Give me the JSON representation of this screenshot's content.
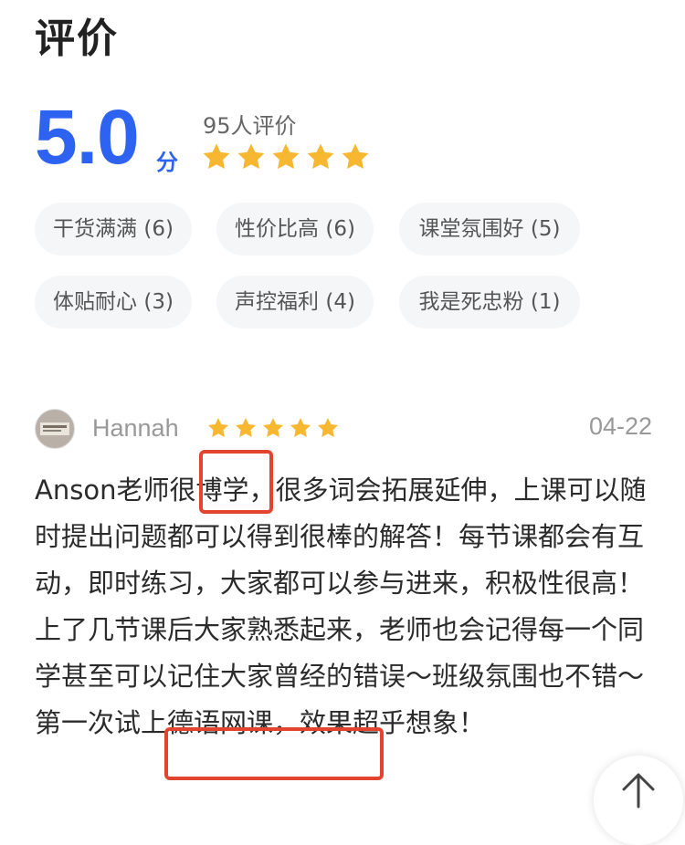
{
  "header": {
    "title": "评价"
  },
  "summary": {
    "score": "5.0",
    "unit": "分",
    "count": "95人评价",
    "rating": 5,
    "star_color": "#f7b731",
    "accent": "#2e63f2"
  },
  "tags": [
    {
      "label": "干货满满 (6)"
    },
    {
      "label": "性价比高 (6)"
    },
    {
      "label": "课堂氛围好 (5)"
    },
    {
      "label": "体贴耐心 (3)"
    },
    {
      "label": "声控福利 (4)"
    },
    {
      "label": "我是死忠粉 (1)"
    }
  ],
  "review": {
    "author": "Hannah",
    "date": "04-22",
    "rating": 5,
    "text": "Anson老师很博学，很多词会拓展延伸，上课可以随时提出问题都可以得到很棒的解答！每节课都会有互动，即时练习，大家都可以参与进来，积极性很高！上了几节课后大家熟悉起来，老师也会记得每一个同学甚至可以记住大家曾经的错误～班级氛围也不错～第一次试上德语网课，效果超乎想象！",
    "highlight_color": "#e2442f"
  },
  "controls": {
    "back_to_top_icon": "arrow-up-icon"
  }
}
